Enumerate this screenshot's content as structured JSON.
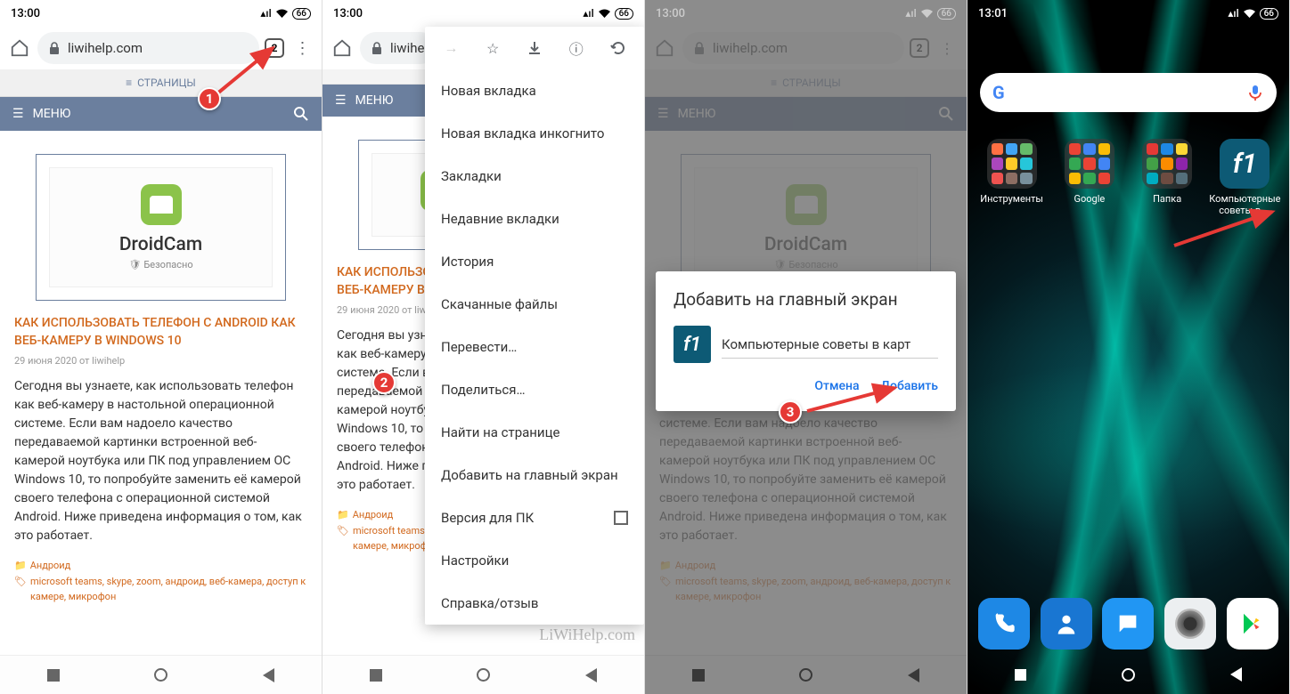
{
  "status": {
    "time1": "13:00",
    "time4": "13:01",
    "battery": "66"
  },
  "toolbar": {
    "url": "liwihelp.com",
    "tabs": "2"
  },
  "site": {
    "pages": "СТРАНИЦЫ",
    "menu": "МЕНЮ",
    "card_title": "DroidCam",
    "card_safe": "Безопасно",
    "article_title": "КАК ИСПОЛЬЗОВАТЬ ТЕЛЕФОН С ANDROID КАК ВЕБ-КАМЕРУ В WINDOWS 10",
    "article_title_short": "КАК ИСПОЛЬЗО\nВЕБ-КАМЕРУ В",
    "article_meta": "29 июня 2020 от liwihelp",
    "article_body": "Сегодня вы узнаете, как использовать телефон как веб-камеру в настольной операционной системе. Если вам надоело качество передаваемой картинки встроенной веб-камерой ноутбука или ПК под управлением ОС Windows 10, то попробуйте заменить её камерой своего телефона с операционной системой Android. Ниже приведена информация о том, как это работает.",
    "cat": "Андроид",
    "tags": "microsoft teams, skype, zoom, андроид, веб-камера, доступ к камере, микрофон"
  },
  "menu": {
    "items": [
      "Новая вкладка",
      "Новая вкладка инкогнито",
      "Закладки",
      "Недавние вкладки",
      "История",
      "Скачанные файлы",
      "Перевести…",
      "Поделиться…",
      "Найти на странице",
      "Добавить на главный экран",
      "Версия для ПК",
      "Настройки",
      "Справка/отзыв"
    ]
  },
  "modal": {
    "title": "Добавить на главный экран",
    "input": "Компьютерные советы в карт",
    "cancel": "Отмена",
    "add": "Добавить"
  },
  "home": {
    "folders": [
      "Инструменты",
      "Google",
      "Папка"
    ],
    "shortcut": "Компьютерные советы в ..."
  },
  "watermark": "LiWiHelp.com",
  "callouts": {
    "c1": "1",
    "c2": "2",
    "c3": "3"
  }
}
